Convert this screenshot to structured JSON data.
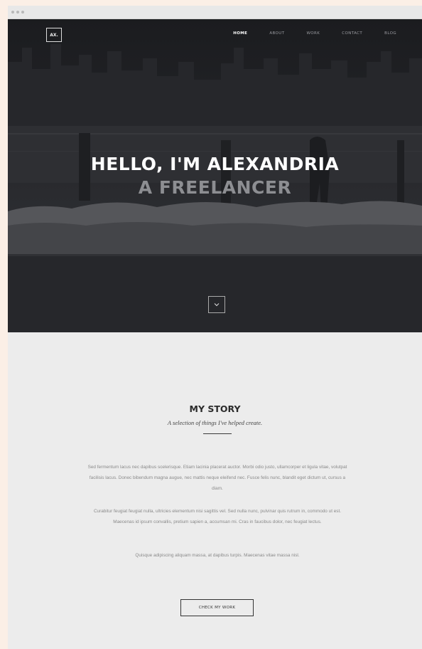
{
  "brand": {
    "logo_text": "AX."
  },
  "nav": {
    "items": [
      {
        "label": "HOME",
        "active": true
      },
      {
        "label": "ABOUT",
        "active": false
      },
      {
        "label": "WORK",
        "active": false
      },
      {
        "label": "CONTACT",
        "active": false
      },
      {
        "label": "BLOG",
        "active": false
      }
    ]
  },
  "hero": {
    "title": "HELLO, I'M ALEXANDRIA",
    "subtitle": "A FREELANCER",
    "scroll_icon": "chevron-down-icon"
  },
  "story": {
    "title": "MY STORY",
    "tagline": "A selection of things I've helped create.",
    "paragraphs": [
      "Sed fermentum lacus nec dapibus scelerisque. Etiam lacinia placerat auctor. Morbi odio justo, ullamcorper et ligula vitae, volutpat facilisis lacus. Donec bibendum magna augue, nec mattis neque eleifend nec. Fusce felis nunc, blandit eget dictum ut, cursus a diam.",
      "Curabitur feugiat feugiat nulla, ultricies elementum nisi sagittis vel. Sed nulla nunc, pulvinar quis rutrum in, commodo ut est. Maecenas id ipsum convallis, pretium sapien a, accumsan mi. Cras in faucibus dolor, nec feugiat lectus.",
      "Quisque adipiscing aliquam massa, at dapibus turpis. Maecenas vitae massa nisl."
    ],
    "cta_label": "CHECK MY WORK"
  },
  "colors": {
    "page_bg": "#fbefe6",
    "hero_bg": "#212226",
    "content_bg": "#ececec",
    "accent_text": "#2b2b2b"
  }
}
